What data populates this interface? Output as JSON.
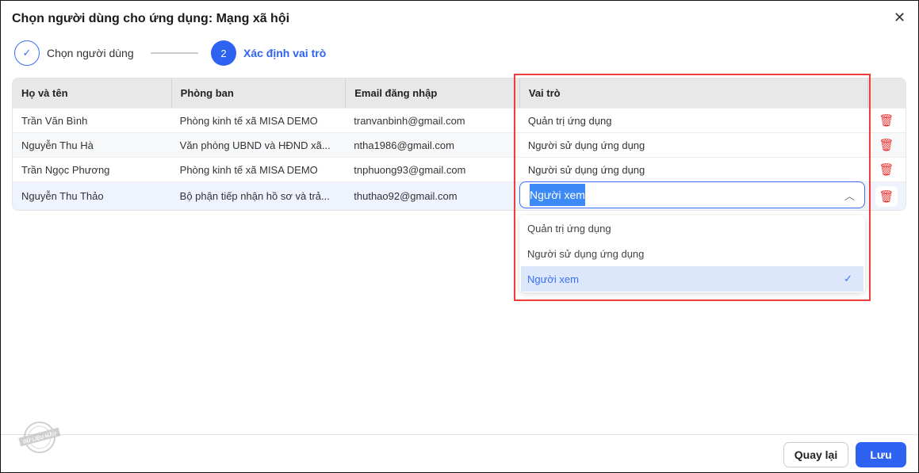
{
  "dialog": {
    "title": "Chọn người dùng cho ứng dụng: Mạng xã hội",
    "close_icon": "close-icon"
  },
  "steps": [
    {
      "label": "Chọn người dùng",
      "status": "done"
    },
    {
      "number": "2",
      "label": "Xác định vai trò",
      "status": "active"
    }
  ],
  "table": {
    "headers": [
      "Họ và tên",
      "Phòng ban",
      "Email đăng nhập",
      "Vai trò"
    ],
    "rows": [
      {
        "name": "Trần Văn Bình",
        "dept": "Phòng kinh tế xã MISA DEMO",
        "email": "tranvanbinh@gmail.com",
        "role": "Quản trị ứng dụng"
      },
      {
        "name": "Nguyễn Thu Hà",
        "dept": "Văn phòng UBND và HĐND xã...",
        "email": "ntha1986@gmail.com",
        "role": "Người sử dụng ứng dụng"
      },
      {
        "name": "Trần Ngọc Phương",
        "dept": "Phòng kinh tế xã MISA DEMO",
        "email": "tnphuong93@gmail.com",
        "role": "Người sử dụng ứng dụng"
      },
      {
        "name": "Nguyễn Thu Thảo",
        "dept": "Bộ phận tiếp nhận hồ sơ và trả...",
        "email": "thuthao92@gmail.com",
        "role": "Người xem"
      }
    ]
  },
  "role_dropdown": {
    "options": [
      "Quản trị ứng dụng",
      "Người sử dụng ứng dụng",
      "Người xem"
    ],
    "selected": "Người xem"
  },
  "watermark": "DỮ LIỆU MẪU",
  "footer": {
    "back": "Quay lại",
    "save": "Lưu"
  },
  "colors": {
    "primary": "#2d63f0",
    "danger": "#e33333",
    "highlight": "#ef3d3d"
  }
}
